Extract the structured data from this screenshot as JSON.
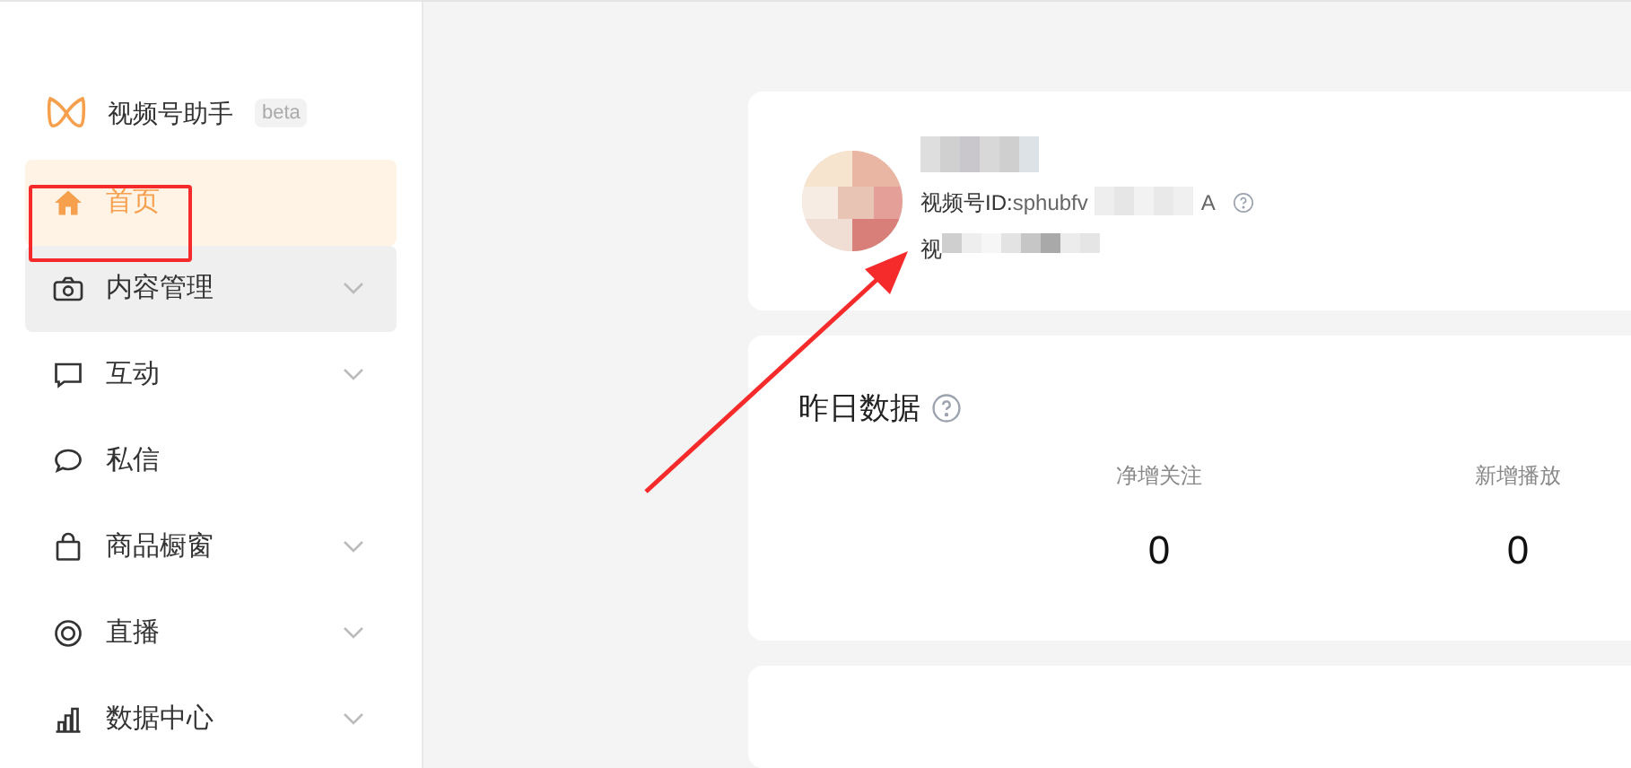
{
  "sidebar": {
    "brand": "视频号助手",
    "badge": "beta",
    "items": [
      {
        "label": "首页",
        "kind": "home",
        "selected": true,
        "hovered": false,
        "has_submenu": false
      },
      {
        "label": "内容管理",
        "kind": "camera",
        "selected": false,
        "hovered": true,
        "has_submenu": true
      },
      {
        "label": "互动",
        "kind": "comment",
        "selected": false,
        "hovered": false,
        "has_submenu": true
      },
      {
        "label": "私信",
        "kind": "chat",
        "selected": false,
        "hovered": false,
        "has_submenu": false
      },
      {
        "label": "商品橱窗",
        "kind": "bag",
        "selected": false,
        "hovered": false,
        "has_submenu": true
      },
      {
        "label": "直播",
        "kind": "live",
        "selected": false,
        "hovered": false,
        "has_submenu": true
      },
      {
        "label": "数据中心",
        "kind": "chart",
        "selected": false,
        "hovered": false,
        "has_submenu": true
      }
    ]
  },
  "profile": {
    "id_label": "视频号ID:",
    "id_start": "sphubfv",
    "id_end": "A",
    "line_3_start": "视"
  },
  "yesterday": {
    "title": "昨日数据",
    "stats": [
      {
        "label": "净增关注",
        "value": "0"
      },
      {
        "label": "新增播放",
        "value": "0"
      }
    ]
  }
}
